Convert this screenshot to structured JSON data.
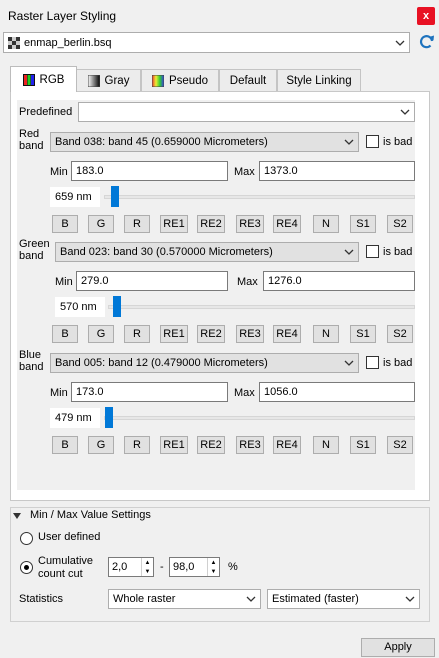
{
  "window": {
    "title": "Raster Layer Styling",
    "close_glyph": "x"
  },
  "layer": {
    "selected": "enmap_berlin.bsq"
  },
  "tabs": [
    {
      "label": "RGB",
      "icon": "rgb-icon",
      "active": true
    },
    {
      "label": "Gray",
      "icon": "gray-icon",
      "active": false
    },
    {
      "label": "Pseudo",
      "icon": "pseudo-icon",
      "active": false
    },
    {
      "label": "Default",
      "active": false
    },
    {
      "label": "Style Linking",
      "active": false
    }
  ],
  "predefined": {
    "label": "Predefined",
    "value": ""
  },
  "band_buttons": [
    "B",
    "G",
    "R",
    "RE1",
    "RE2",
    "RE3",
    "RE4",
    "N",
    "S1",
    "S2"
  ],
  "bands": [
    {
      "label": "Red band",
      "name": "Band 038: band 45 (0.659000 Micrometers)",
      "is_bad": "is bad",
      "min_label": "Min",
      "min": "183.0",
      "max_label": "Max",
      "max": "1373.0",
      "wavelength": "659 nm"
    },
    {
      "label": "Green band",
      "name": "Band 023: band 30 (0.570000 Micrometers)",
      "is_bad": "is bad",
      "min_label": "Min",
      "min": "279.0",
      "max_label": "Max",
      "max": "1276.0",
      "wavelength": "570 nm"
    },
    {
      "label": "Blue band",
      "name": "Band 005: band 12 (0.479000 Micrometers)",
      "is_bad": "is bad",
      "min_label": "Min",
      "min": "173.0",
      "max_label": "Max",
      "max": "1056.0",
      "wavelength": "479 nm"
    }
  ],
  "minmax": {
    "title": "Min / Max Value Settings",
    "user_defined": "User defined",
    "cumulative": "Cumulative count cut",
    "cut_low": "2,0",
    "dash": "-",
    "cut_high": "98,0",
    "percent": "%",
    "statistics_label": "Statistics",
    "statistics_value": "Whole raster",
    "accuracy_value": "Estimated (faster)"
  },
  "apply_label": "Apply",
  "colors": {
    "accent": "#0078d7",
    "close": "#e81123",
    "refresh": "#1e73be"
  }
}
